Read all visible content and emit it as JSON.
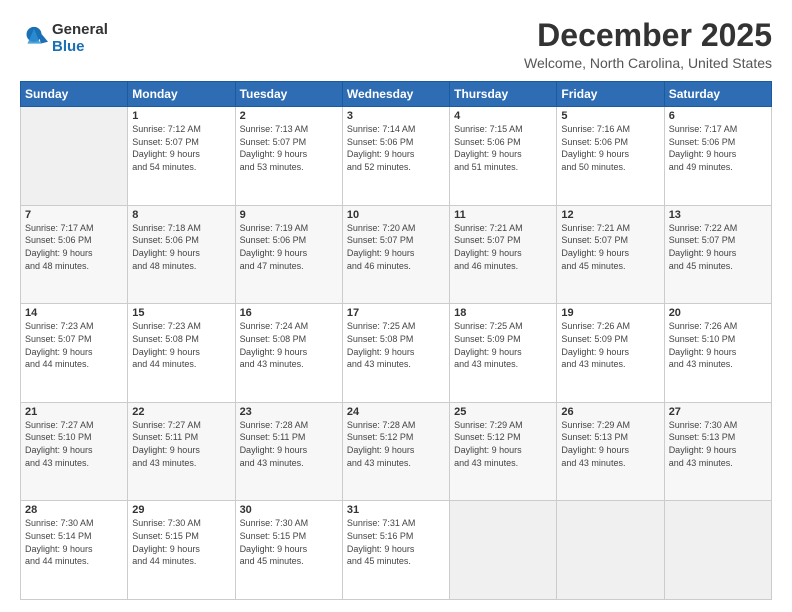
{
  "logo": {
    "general": "General",
    "blue": "Blue"
  },
  "header": {
    "month": "December 2025",
    "location": "Welcome, North Carolina, United States"
  },
  "days_of_week": [
    "Sunday",
    "Monday",
    "Tuesday",
    "Wednesday",
    "Thursday",
    "Friday",
    "Saturday"
  ],
  "weeks": [
    [
      {
        "day": "",
        "info": ""
      },
      {
        "day": "1",
        "info": "Sunrise: 7:12 AM\nSunset: 5:07 PM\nDaylight: 9 hours\nand 54 minutes."
      },
      {
        "day": "2",
        "info": "Sunrise: 7:13 AM\nSunset: 5:07 PM\nDaylight: 9 hours\nand 53 minutes."
      },
      {
        "day": "3",
        "info": "Sunrise: 7:14 AM\nSunset: 5:06 PM\nDaylight: 9 hours\nand 52 minutes."
      },
      {
        "day": "4",
        "info": "Sunrise: 7:15 AM\nSunset: 5:06 PM\nDaylight: 9 hours\nand 51 minutes."
      },
      {
        "day": "5",
        "info": "Sunrise: 7:16 AM\nSunset: 5:06 PM\nDaylight: 9 hours\nand 50 minutes."
      },
      {
        "day": "6",
        "info": "Sunrise: 7:17 AM\nSunset: 5:06 PM\nDaylight: 9 hours\nand 49 minutes."
      }
    ],
    [
      {
        "day": "7",
        "info": "Sunrise: 7:17 AM\nSunset: 5:06 PM\nDaylight: 9 hours\nand 48 minutes."
      },
      {
        "day": "8",
        "info": "Sunrise: 7:18 AM\nSunset: 5:06 PM\nDaylight: 9 hours\nand 48 minutes."
      },
      {
        "day": "9",
        "info": "Sunrise: 7:19 AM\nSunset: 5:06 PM\nDaylight: 9 hours\nand 47 minutes."
      },
      {
        "day": "10",
        "info": "Sunrise: 7:20 AM\nSunset: 5:07 PM\nDaylight: 9 hours\nand 46 minutes."
      },
      {
        "day": "11",
        "info": "Sunrise: 7:21 AM\nSunset: 5:07 PM\nDaylight: 9 hours\nand 46 minutes."
      },
      {
        "day": "12",
        "info": "Sunrise: 7:21 AM\nSunset: 5:07 PM\nDaylight: 9 hours\nand 45 minutes."
      },
      {
        "day": "13",
        "info": "Sunrise: 7:22 AM\nSunset: 5:07 PM\nDaylight: 9 hours\nand 45 minutes."
      }
    ],
    [
      {
        "day": "14",
        "info": "Sunrise: 7:23 AM\nSunset: 5:07 PM\nDaylight: 9 hours\nand 44 minutes."
      },
      {
        "day": "15",
        "info": "Sunrise: 7:23 AM\nSunset: 5:08 PM\nDaylight: 9 hours\nand 44 minutes."
      },
      {
        "day": "16",
        "info": "Sunrise: 7:24 AM\nSunset: 5:08 PM\nDaylight: 9 hours\nand 43 minutes."
      },
      {
        "day": "17",
        "info": "Sunrise: 7:25 AM\nSunset: 5:08 PM\nDaylight: 9 hours\nand 43 minutes."
      },
      {
        "day": "18",
        "info": "Sunrise: 7:25 AM\nSunset: 5:09 PM\nDaylight: 9 hours\nand 43 minutes."
      },
      {
        "day": "19",
        "info": "Sunrise: 7:26 AM\nSunset: 5:09 PM\nDaylight: 9 hours\nand 43 minutes."
      },
      {
        "day": "20",
        "info": "Sunrise: 7:26 AM\nSunset: 5:10 PM\nDaylight: 9 hours\nand 43 minutes."
      }
    ],
    [
      {
        "day": "21",
        "info": "Sunrise: 7:27 AM\nSunset: 5:10 PM\nDaylight: 9 hours\nand 43 minutes."
      },
      {
        "day": "22",
        "info": "Sunrise: 7:27 AM\nSunset: 5:11 PM\nDaylight: 9 hours\nand 43 minutes."
      },
      {
        "day": "23",
        "info": "Sunrise: 7:28 AM\nSunset: 5:11 PM\nDaylight: 9 hours\nand 43 minutes."
      },
      {
        "day": "24",
        "info": "Sunrise: 7:28 AM\nSunset: 5:12 PM\nDaylight: 9 hours\nand 43 minutes."
      },
      {
        "day": "25",
        "info": "Sunrise: 7:29 AM\nSunset: 5:12 PM\nDaylight: 9 hours\nand 43 minutes."
      },
      {
        "day": "26",
        "info": "Sunrise: 7:29 AM\nSunset: 5:13 PM\nDaylight: 9 hours\nand 43 minutes."
      },
      {
        "day": "27",
        "info": "Sunrise: 7:30 AM\nSunset: 5:13 PM\nDaylight: 9 hours\nand 43 minutes."
      }
    ],
    [
      {
        "day": "28",
        "info": "Sunrise: 7:30 AM\nSunset: 5:14 PM\nDaylight: 9 hours\nand 44 minutes."
      },
      {
        "day": "29",
        "info": "Sunrise: 7:30 AM\nSunset: 5:15 PM\nDaylight: 9 hours\nand 44 minutes."
      },
      {
        "day": "30",
        "info": "Sunrise: 7:30 AM\nSunset: 5:15 PM\nDaylight: 9 hours\nand 45 minutes."
      },
      {
        "day": "31",
        "info": "Sunrise: 7:31 AM\nSunset: 5:16 PM\nDaylight: 9 hours\nand 45 minutes."
      },
      {
        "day": "",
        "info": ""
      },
      {
        "day": "",
        "info": ""
      },
      {
        "day": "",
        "info": ""
      }
    ]
  ]
}
